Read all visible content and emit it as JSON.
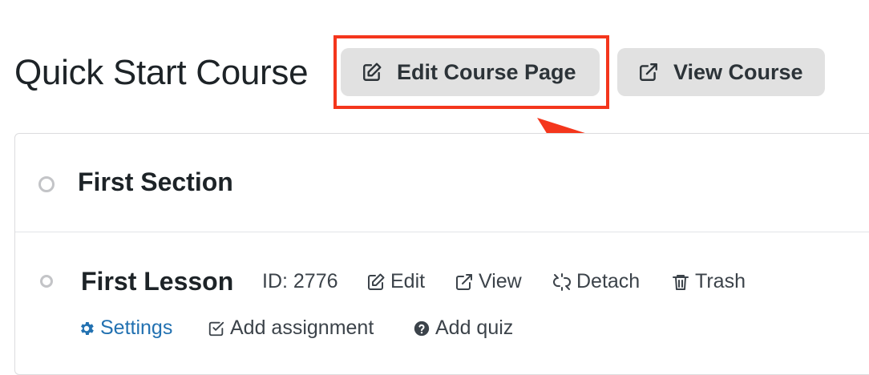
{
  "course": {
    "title": "Quick Start Course"
  },
  "header_buttons": {
    "edit_course_page": {
      "label": "Edit Course Page",
      "icon": "edit-icon"
    },
    "view_course": {
      "label": "View Course",
      "icon": "external-link-icon"
    }
  },
  "annotation": {
    "color": "#f4361c"
  },
  "section": {
    "title": "First Section"
  },
  "lesson": {
    "title": "First Lesson",
    "id_text": "ID: 2776",
    "actions": {
      "edit": "Edit",
      "view": "View",
      "detach": "Detach",
      "trash": "Trash"
    },
    "sub_actions": {
      "settings": "Settings",
      "add_assignment": "Add assignment",
      "add_quiz": "Add quiz"
    }
  },
  "colors": {
    "link": "#2271b1",
    "button_bg": "#e1e1e1",
    "text": "#1d2327"
  }
}
